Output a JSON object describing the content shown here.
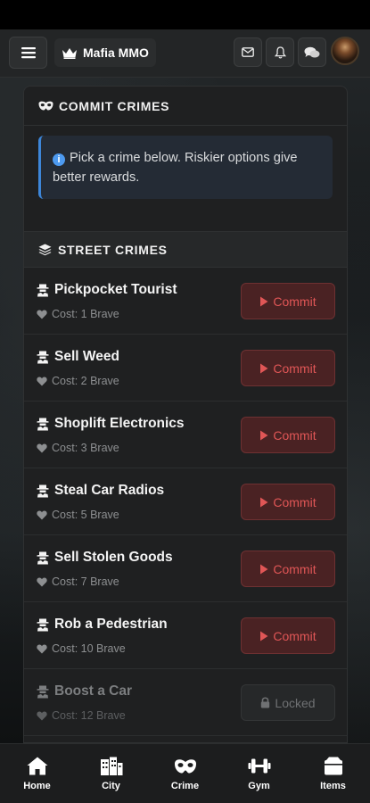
{
  "app": {
    "brand": "Mafia MMO"
  },
  "colors": {
    "accent_red": "#e05656",
    "info_blue": "#4d9af0",
    "panel_bg": "#1f2021"
  },
  "header_icons": [
    "menu-icon",
    "crown-icon",
    "mail-icon",
    "bell-icon",
    "chat-icon",
    "avatar"
  ],
  "panel": {
    "title": "COMMIT CRIMES",
    "info_text": "Pick a crime below. Riskier options give better rewards.",
    "section_title": "STREET CRIMES"
  },
  "crimes": [
    {
      "name": "Pickpocket Tourist",
      "cost": "Cost: 1 Brave",
      "action": "Commit"
    },
    {
      "name": "Sell Weed",
      "cost": "Cost: 2 Brave",
      "action": "Commit"
    },
    {
      "name": "Shoplift Electronics",
      "cost": "Cost: 3 Brave",
      "action": "Commit"
    },
    {
      "name": "Steal Car Radios",
      "cost": "Cost: 5 Brave",
      "action": "Commit"
    },
    {
      "name": "Sell Stolen Goods",
      "cost": "Cost: 7 Brave",
      "action": "Commit"
    },
    {
      "name": "Rob a Pedestrian",
      "cost": "Cost: 10 Brave",
      "action": "Commit"
    },
    {
      "name": "Boost a Car",
      "cost": "Cost: 12 Brave",
      "action": "Locked",
      "locked": true
    }
  ],
  "nav": [
    {
      "label": "Home",
      "icon": "home-icon"
    },
    {
      "label": "City",
      "icon": "city-icon"
    },
    {
      "label": "Crime",
      "icon": "mask-icon"
    },
    {
      "label": "Gym",
      "icon": "dumbbell-icon"
    },
    {
      "label": "Items",
      "icon": "box-icon"
    }
  ]
}
